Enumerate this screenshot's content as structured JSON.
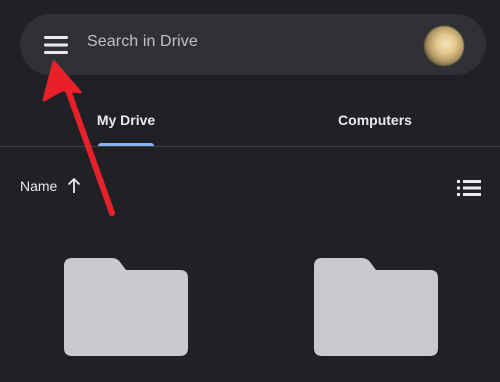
{
  "search": {
    "placeholder": "Search in Drive",
    "menu_icon": "hamburger-menu-icon",
    "avatar_icon": "account-avatar"
  },
  "tabs": [
    {
      "label": "My Drive",
      "selected": true
    },
    {
      "label": "Computers",
      "selected": false
    }
  ],
  "sort": {
    "label": "Name",
    "direction_icon": "arrow-up-icon",
    "view_icon": "list-view-icon"
  },
  "folders": [
    {
      "icon": "folder-icon"
    },
    {
      "icon": "folder-icon"
    }
  ],
  "annotation": {
    "icon": "red-pointer-arrow",
    "color": "#e8202a"
  },
  "colors": {
    "background": "#202124",
    "search_bar": "#303134",
    "accent": "#8ab4f8",
    "folder": "#c9cad0"
  }
}
